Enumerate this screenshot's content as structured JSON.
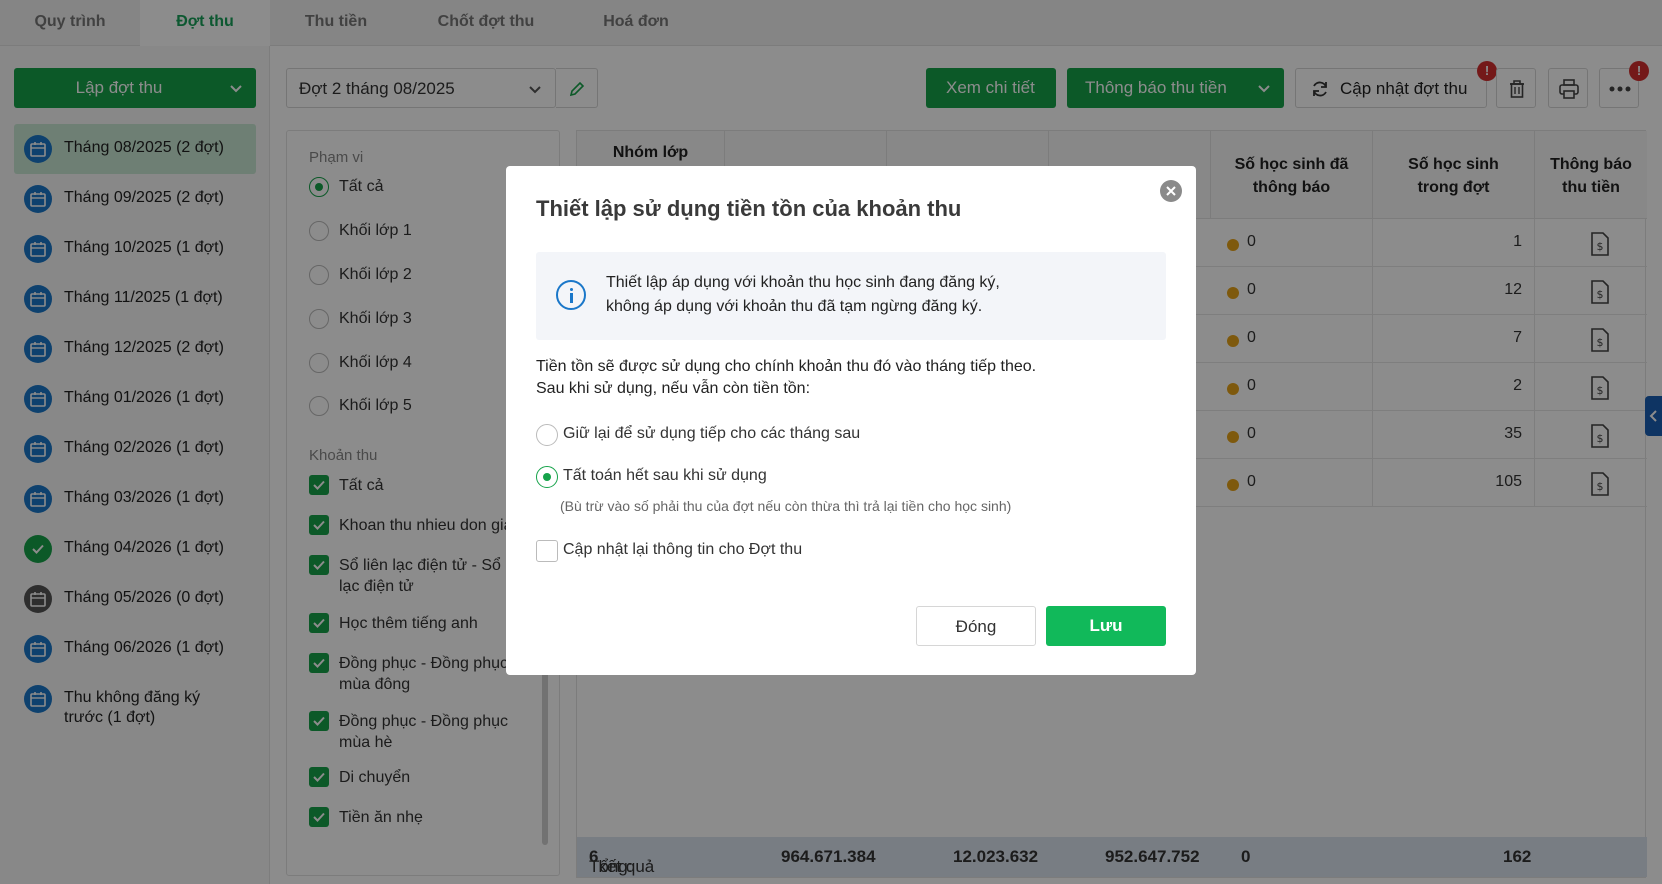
{
  "tabs": [
    "Quy trình",
    "Đợt thu",
    "Thu tiền",
    "Chốt đợt thu",
    "Hoá đơn"
  ],
  "active_tab": "Đợt thu",
  "sidebar": {
    "create_button": "Lập đợt thu",
    "months": [
      {
        "label": "Tháng 08/2025 (2 đợt)",
        "status": "blue",
        "active": true
      },
      {
        "label": "Tháng 09/2025 (2 đợt)",
        "status": "blue"
      },
      {
        "label": "Tháng 10/2025 (1 đợt)",
        "status": "blue"
      },
      {
        "label": "Tháng 11/2025 (1 đợt)",
        "status": "blue"
      },
      {
        "label": "Tháng 12/2025 (2 đợt)",
        "status": "blue"
      },
      {
        "label": "Tháng 01/2026 (1 đợt)",
        "status": "blue"
      },
      {
        "label": "Tháng 02/2026 (1 đợt)",
        "status": "blue"
      },
      {
        "label": "Tháng 03/2026 (1 đợt)",
        "status": "blue"
      },
      {
        "label": "Tháng 04/2026 (1 đợt)",
        "status": "green"
      },
      {
        "label": "Tháng 05/2026 (0 đợt)",
        "status": "gray"
      },
      {
        "label": "Tháng 06/2026 (1 đợt)",
        "status": "blue"
      },
      {
        "label": "Thu không đăng ký trước (1 đợt)",
        "status": "blue"
      }
    ]
  },
  "toolbar": {
    "period_value": "Đợt 2 tháng 08/2025",
    "view_detail": "Xem chi tiết",
    "notify": "Thông báo thu tiền",
    "update": "Cập nhật đợt thu",
    "badge": "!"
  },
  "filter": {
    "scope_title": "Phạm vi",
    "scope_options": [
      "Tất cả",
      "Khối lớp 1",
      "Khối lớp 2",
      "Khối lớp 3",
      "Khối lớp 4",
      "Khối lớp 5"
    ],
    "fee_title": "Khoản thu",
    "fee_options": [
      "Tất cả",
      "Khoan thu nhieu don gia",
      "Sổ liên lạc điện tử - Sổ liên lạc điện tử",
      "Học thêm tiếng anh",
      "Đồng phục - Đồng phục mùa đông",
      "Đồng phục - Đồng phục mùa hè",
      "Di chuyển",
      "Tiền ăn nhẹ"
    ]
  },
  "table": {
    "headers": {
      "group": "Nhóm lớp",
      "notified_1": "Số học sinh đã",
      "notified_2": "thông báo",
      "in_period_1": "Số học sinh",
      "in_period_2": "trong đợt",
      "notice_1": "Thông báo",
      "notice_2": "thu tiền"
    },
    "rows": [
      {
        "notified": "0",
        "students": "1"
      },
      {
        "notified": "0",
        "students": "12"
      },
      {
        "notified": "0",
        "students": "7"
      },
      {
        "notified": "0",
        "students": "2"
      },
      {
        "notified": "0",
        "students": "35"
      },
      {
        "notified": "0",
        "students": "105"
      }
    ],
    "footer": {
      "label": "Tổng:",
      "count": "6",
      "suffix": "kết quả",
      "total_1": "964.671.384",
      "total_2": "12.023.632",
      "total_3": "952.647.752",
      "notified": "0",
      "students": "162"
    }
  },
  "modal": {
    "title": "Thiết lập sử dụng tiền tồn của khoản thu",
    "info_line1": "Thiết lập áp dụng với khoản thu học sinh đang đăng ký,",
    "info_line2": "không áp dụng với khoản thu đã tạm ngừng đăng ký.",
    "desc_line1": "Tiền tồn sẽ được sử dụng cho chính khoản thu đó vào tháng tiếp theo.",
    "desc_line2": "Sau khi sử dụng, nếu vẫn còn tiền tồn:",
    "option_keep": "Giữ lại để sử dụng tiếp cho các tháng sau",
    "option_settle": "Tất toán hết sau khi sử dụng",
    "option_settle_note": "(Bù trừ vào số phải thu của đợt nếu còn thừa thì trả lại tiền cho học sinh)",
    "option_update": "Cập nhật lại thông tin cho Đợt thu",
    "cancel": "Đóng",
    "save": "Lưu"
  },
  "colors": {
    "primary_green": "#16a34a",
    "save_green": "#11b95a",
    "info_blue": "#1a77c9",
    "dot_orange": "#e6a219"
  }
}
